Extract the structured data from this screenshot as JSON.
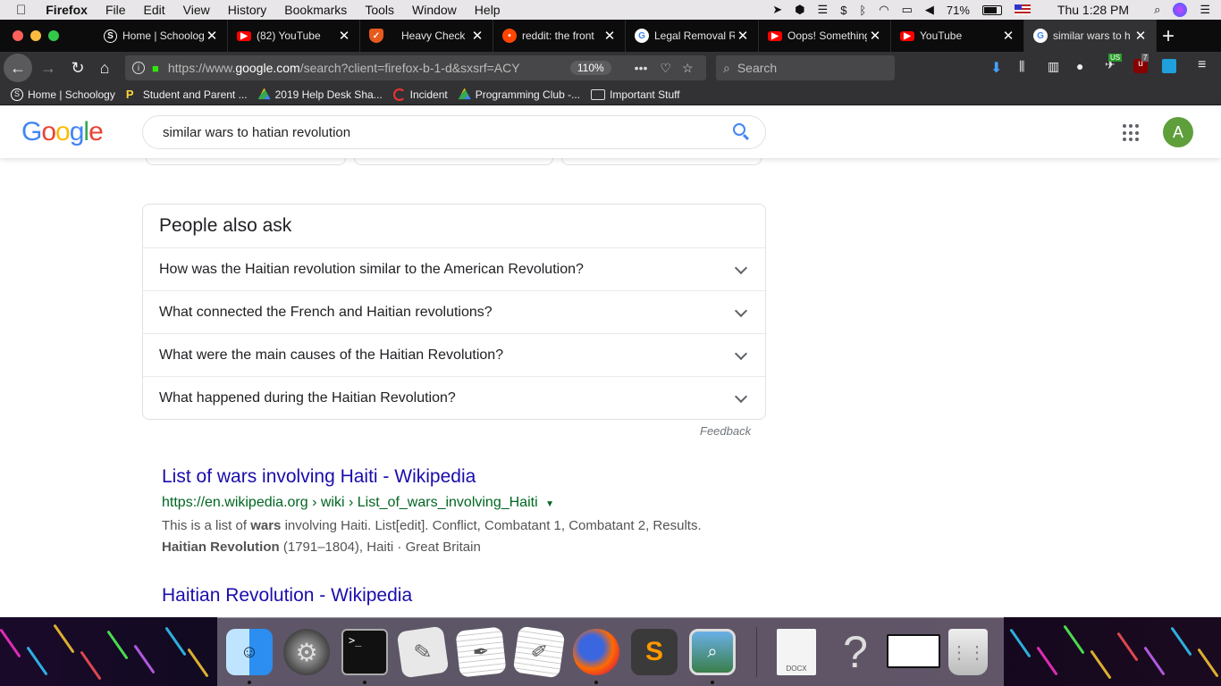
{
  "menubar": {
    "app": "Firefox",
    "items": [
      "File",
      "Edit",
      "View",
      "History",
      "Bookmarks",
      "Tools",
      "Window",
      "Help"
    ],
    "battery": "71%",
    "clock": "Thu 1:28 PM"
  },
  "tabs": [
    {
      "label": "Home | Schoolog",
      "icon": "schoology-icon"
    },
    {
      "label": "(82) YouTube",
      "icon": "youtube-icon"
    },
    {
      "label": "Heavy Check",
      "icon": "shield-icon"
    },
    {
      "label": "reddit: the front",
      "icon": "reddit-icon"
    },
    {
      "label": "Legal Removal Re",
      "icon": "google-icon"
    },
    {
      "label": "Oops! Something",
      "icon": "youtube-icon"
    },
    {
      "label": "YouTube",
      "icon": "youtube-icon"
    },
    {
      "label": "similar wars to h",
      "icon": "google-icon",
      "active": true
    }
  ],
  "nav": {
    "url_prefix": "https://www.",
    "url_domain": "google.com",
    "url_rest": "/search?client=firefox-b-1-d&sxsrf=ACY",
    "zoom": "110%",
    "more": "•••",
    "search_placeholder": "Search",
    "badge_us": "US",
    "badge_count": "7"
  },
  "bookmarks": [
    {
      "label": "Home | Schoology",
      "icon": "schoology-icon"
    },
    {
      "label": "Student and Parent ...",
      "icon": "p-icon"
    },
    {
      "label": "2019 Help Desk Sha...",
      "icon": "drive-icon"
    },
    {
      "label": "Incident",
      "icon": "incident-icon"
    },
    {
      "label": "Programming Club -...",
      "icon": "drive-icon"
    },
    {
      "label": "Important Stuff",
      "icon": "folder-icon"
    }
  ],
  "google": {
    "query": "similar wars to hatian revolution",
    "avatar_letter": "A"
  },
  "paa": {
    "title": "People also ask",
    "questions": [
      "How was the Haitian revolution similar to the American Revolution?",
      "What connected the French and Haitian revolutions?",
      "What were the main causes of the Haitian Revolution?",
      "What happened during the Haitian Revolution?"
    ],
    "feedback": "Feedback"
  },
  "results": [
    {
      "title": "List of wars involving Haiti - Wikipedia",
      "url": "https://en.wikipedia.org › wiki › List_of_wars_involving_Haiti",
      "snippet_line1_a": "This is a list of ",
      "snippet_line1_b": "wars",
      "snippet_line1_c": " involving Haiti. List[edit]. Conflict, Combatant 1, Combatant 2, Results.",
      "snippet_line2_a": "Haitian Revolution",
      "snippet_line2_b": " (1791–1804), Haiti · Great Britain"
    },
    {
      "title": "Haitian Revolution - Wikipedia"
    }
  ],
  "dock": {
    "docx_label": "DOCX"
  }
}
